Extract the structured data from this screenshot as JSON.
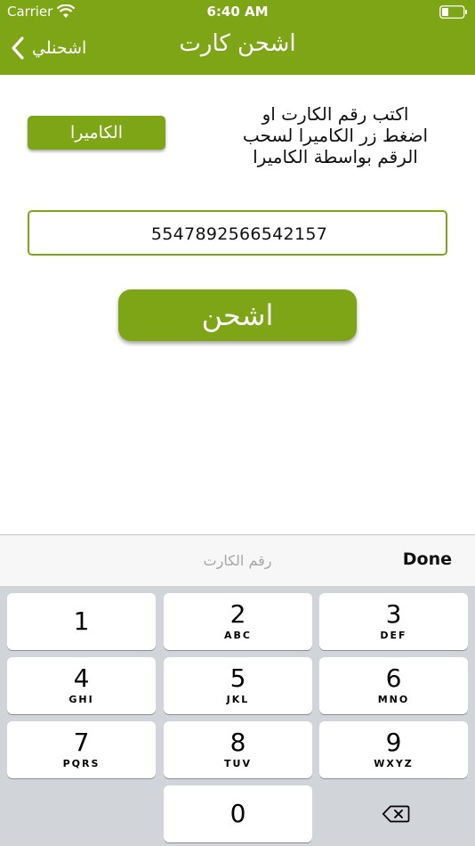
{
  "status_bar": {
    "carrier": "Carrier",
    "time": "6:40 AM",
    "wifi_icon": "wifi-icon",
    "battery_icon": "battery-icon"
  },
  "nav": {
    "back_label": "اشحنلي",
    "back_icon": "chevron-left-icon",
    "title": "اشحن كارت"
  },
  "content": {
    "instruction_line1": "اكتب رقم الكارت او",
    "instruction_line2": "اضغط زر الكاميرا لسحب",
    "instruction_line3": "الرقم بواسطة الكاميرا",
    "camera_button_label": "الكاميرا",
    "card_input_value": "5547892566542157",
    "charge_button_label": "اشحن"
  },
  "accessory": {
    "placeholder_hint": "رقم الكارت",
    "done_label": "Done"
  },
  "keyboard": {
    "keys": [
      {
        "digit": "1",
        "letters": ""
      },
      {
        "digit": "2",
        "letters": "ABC"
      },
      {
        "digit": "3",
        "letters": "DEF"
      },
      {
        "digit": "4",
        "letters": "GHI"
      },
      {
        "digit": "5",
        "letters": "JKL"
      },
      {
        "digit": "6",
        "letters": "MNO"
      },
      {
        "digit": "7",
        "letters": "PQRS"
      },
      {
        "digit": "8",
        "letters": "TUV"
      },
      {
        "digit": "9",
        "letters": "WXYZ"
      },
      {
        "digit": "0",
        "letters": ""
      }
    ],
    "delete_icon": "backspace-icon"
  },
  "colors": {
    "brand_green": "#7ea516",
    "keyboard_background": "#d1d4d9",
    "accessory_background": "#f7f7f7"
  }
}
